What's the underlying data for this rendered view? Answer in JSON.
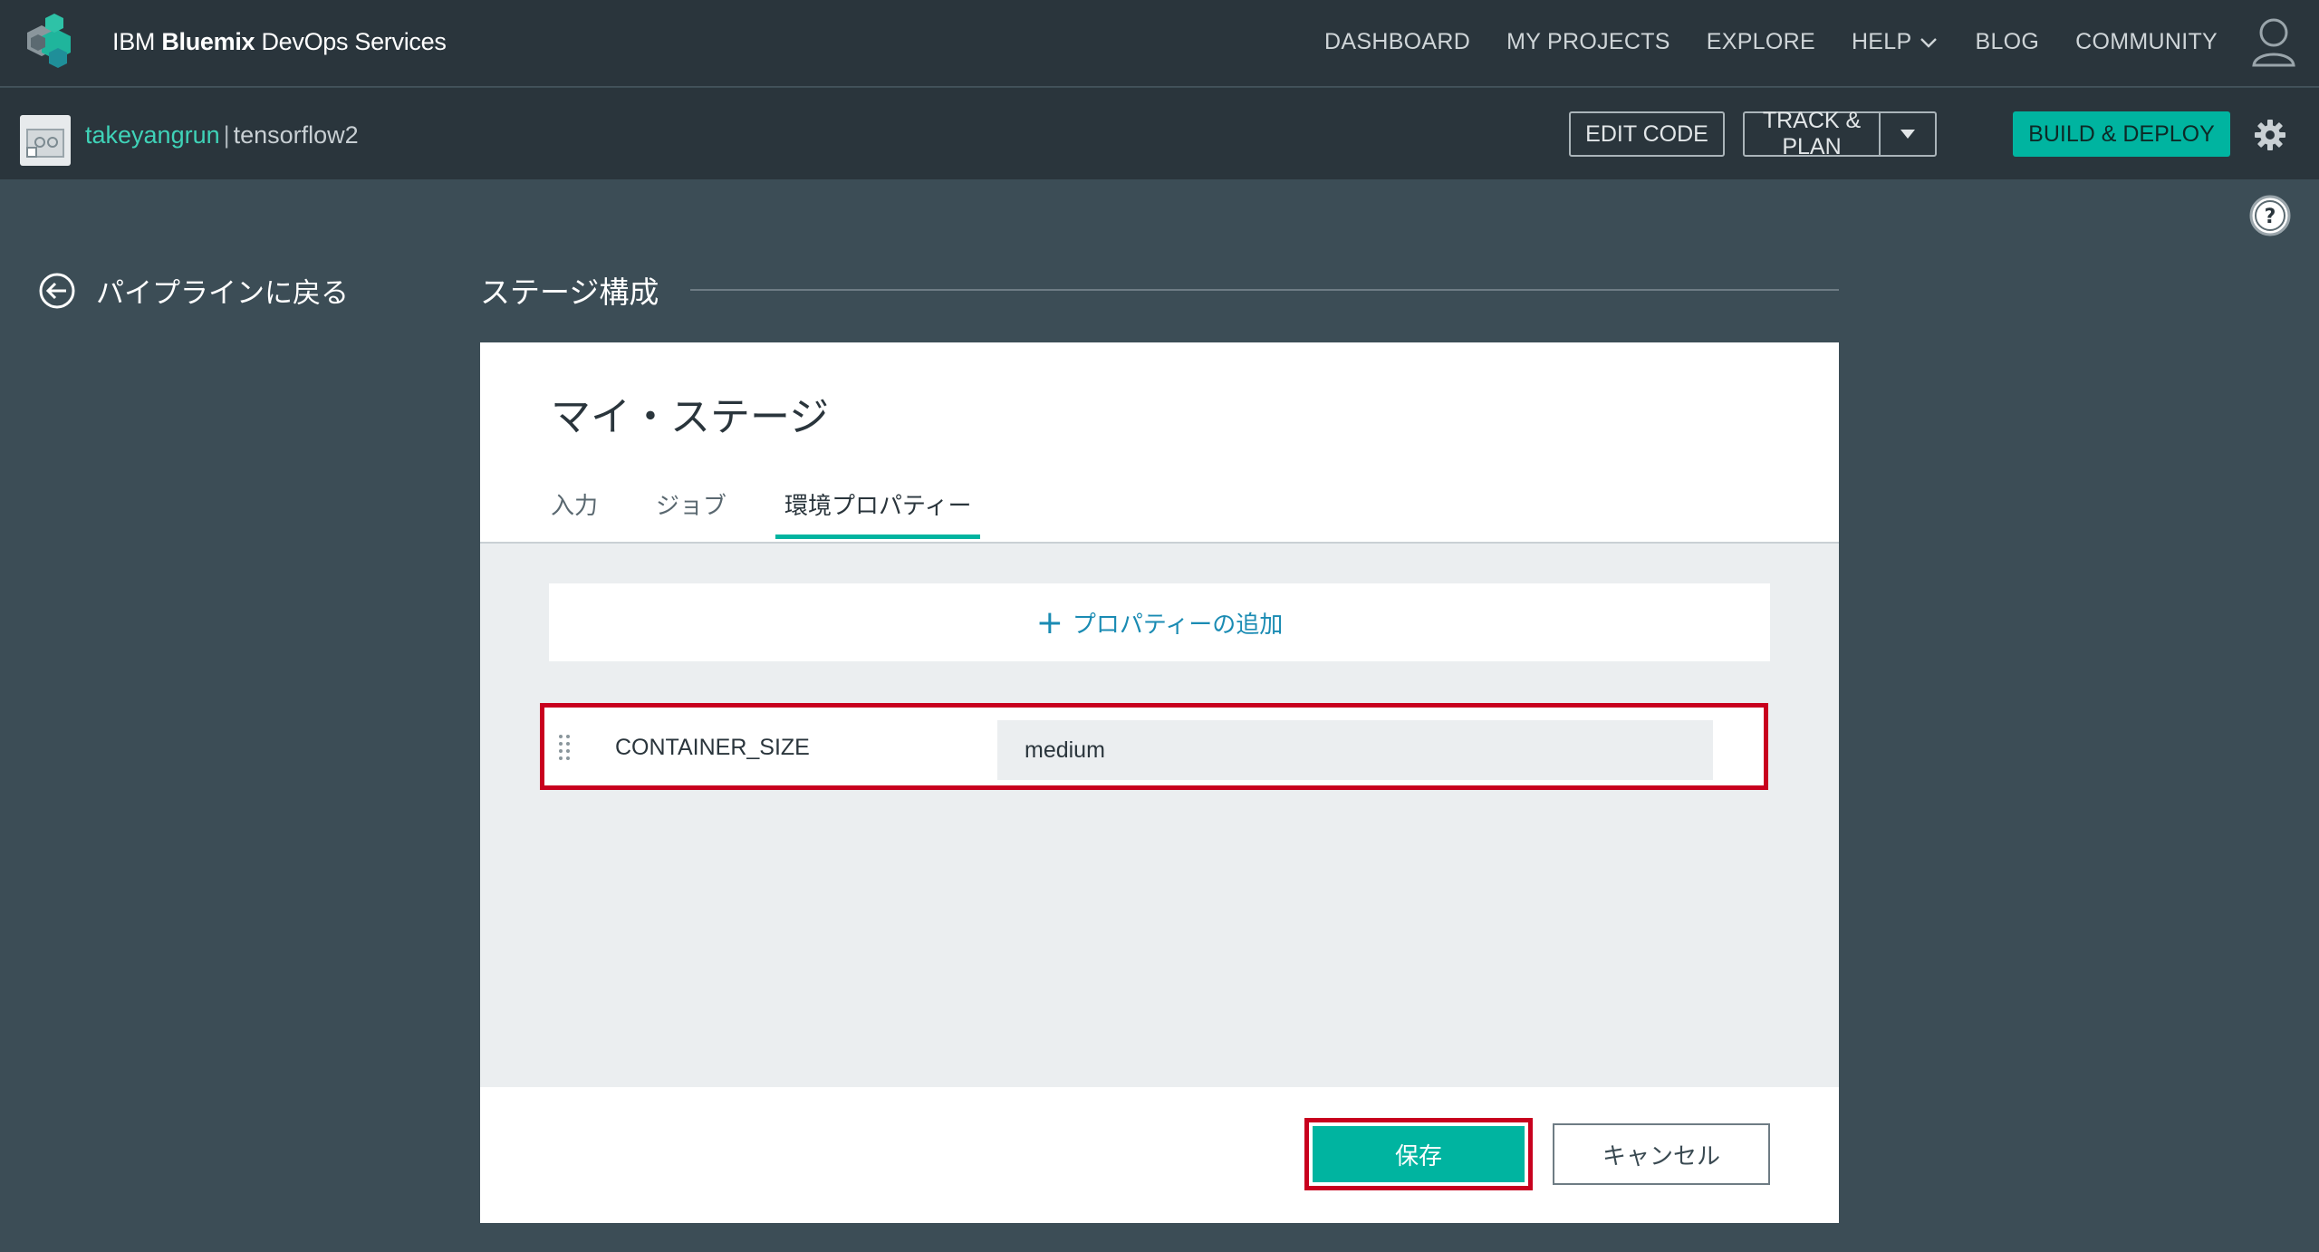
{
  "header": {
    "brand_prefix": "IBM ",
    "brand_bold": "Bluemix",
    "brand_suffix": " DevOps Services",
    "nav": [
      "DASHBOARD",
      "MY PROJECTS",
      "EXPLORE",
      "HELP",
      "BLOG",
      "COMMUNITY"
    ]
  },
  "project": {
    "owner": "takeyangrun",
    "separator": "|",
    "name": "tensorflow2",
    "edit_code": "EDIT CODE",
    "track_plan": "TRACK & PLAN",
    "build_deploy": "BUILD & DEPLOY"
  },
  "back_link": "パイプラインに戻る",
  "page_title": "ステージ構成",
  "stage": {
    "name": "マイ・ステージ",
    "tabs": [
      "入力",
      "ジョブ",
      "環境プロパティー"
    ],
    "active_tab": "環境プロパティー",
    "add_property": "プロパティーの追加",
    "property": {
      "name": "CONTAINER_SIZE",
      "value": "medium"
    },
    "save": "保存",
    "cancel": "キャンセル"
  },
  "colors": {
    "accent": "#00b4a0",
    "header_bg": "#2a353c",
    "page_bg": "#3c4d56",
    "highlight": "#c8001e",
    "link": "#1a8bb3"
  }
}
